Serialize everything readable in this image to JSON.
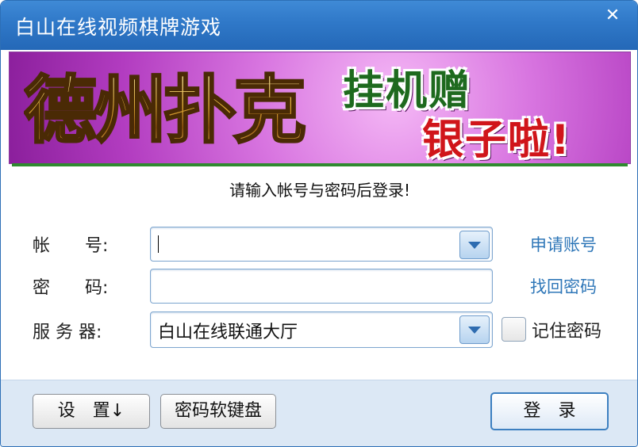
{
  "window": {
    "title": "白山在线视频棋牌游戏",
    "close_glyph": "✕"
  },
  "banner": {
    "logo_text": "德州扑克",
    "slogan_line1": "挂机赠",
    "slogan_line2": "银子啦!"
  },
  "prompt": "请输入帐号与密码后登录!",
  "form": {
    "account": {
      "label": "帐　　号:",
      "value": "",
      "link": "申请账号"
    },
    "password": {
      "label": "密　　码:",
      "value": "",
      "link": "找回密码"
    },
    "server": {
      "label": "服 务 器:",
      "value": "白山在线联通大厅",
      "remember_label": "记住密码",
      "remember_checked": false
    }
  },
  "buttons": {
    "settings": "设　置↓",
    "soft_keyboard": "密码软键盘",
    "login": "登　录"
  },
  "colors": {
    "titlebar": "#2f78c8",
    "link": "#2f77b8",
    "banner_bg": "#c04fcf",
    "bottom_bar": "#dce8f5"
  }
}
